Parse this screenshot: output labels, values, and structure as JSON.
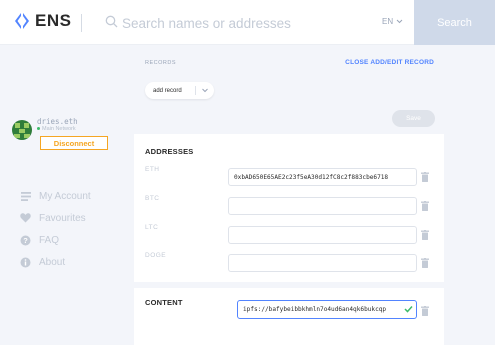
{
  "header": {
    "logo_text": "ENS",
    "search_placeholder": "Search names or addresses",
    "language": "EN",
    "search_button": "Search"
  },
  "account": {
    "name": "dries.eth",
    "network": "Main Network",
    "disconnect_label": "Disconnect"
  },
  "nav": {
    "items": [
      {
        "label": "My Account",
        "icon": "list-icon"
      },
      {
        "label": "Favourites",
        "icon": "heart-icon"
      },
      {
        "label": "FAQ",
        "icon": "question-icon"
      },
      {
        "label": "About",
        "icon": "info-icon"
      }
    ]
  },
  "records": {
    "label": "RECORDS",
    "close_link": "CLOSE ADD/EDIT RECORD",
    "add_record_select": "add record",
    "save_label": "Save"
  },
  "addresses": {
    "title": "ADDRESSES",
    "rows": [
      {
        "coin": "ETH",
        "value": "0xbAD650E65AE2c23f5eA30d12fC8c2f883cbe6718"
      },
      {
        "coin": "BTC",
        "value": ""
      },
      {
        "coin": "LTC",
        "value": ""
      },
      {
        "coin": "DOGE",
        "value": ""
      }
    ]
  },
  "content": {
    "title": "CONTENT",
    "value": "ipfs://bafybeibbkhmln7o4ud6an4qk6bukcqp"
  },
  "colors": {
    "accent": "#5284ff",
    "warning": "#f5a623",
    "search_button_bg": "#cfd9e9",
    "success": "#3dbb6b"
  }
}
